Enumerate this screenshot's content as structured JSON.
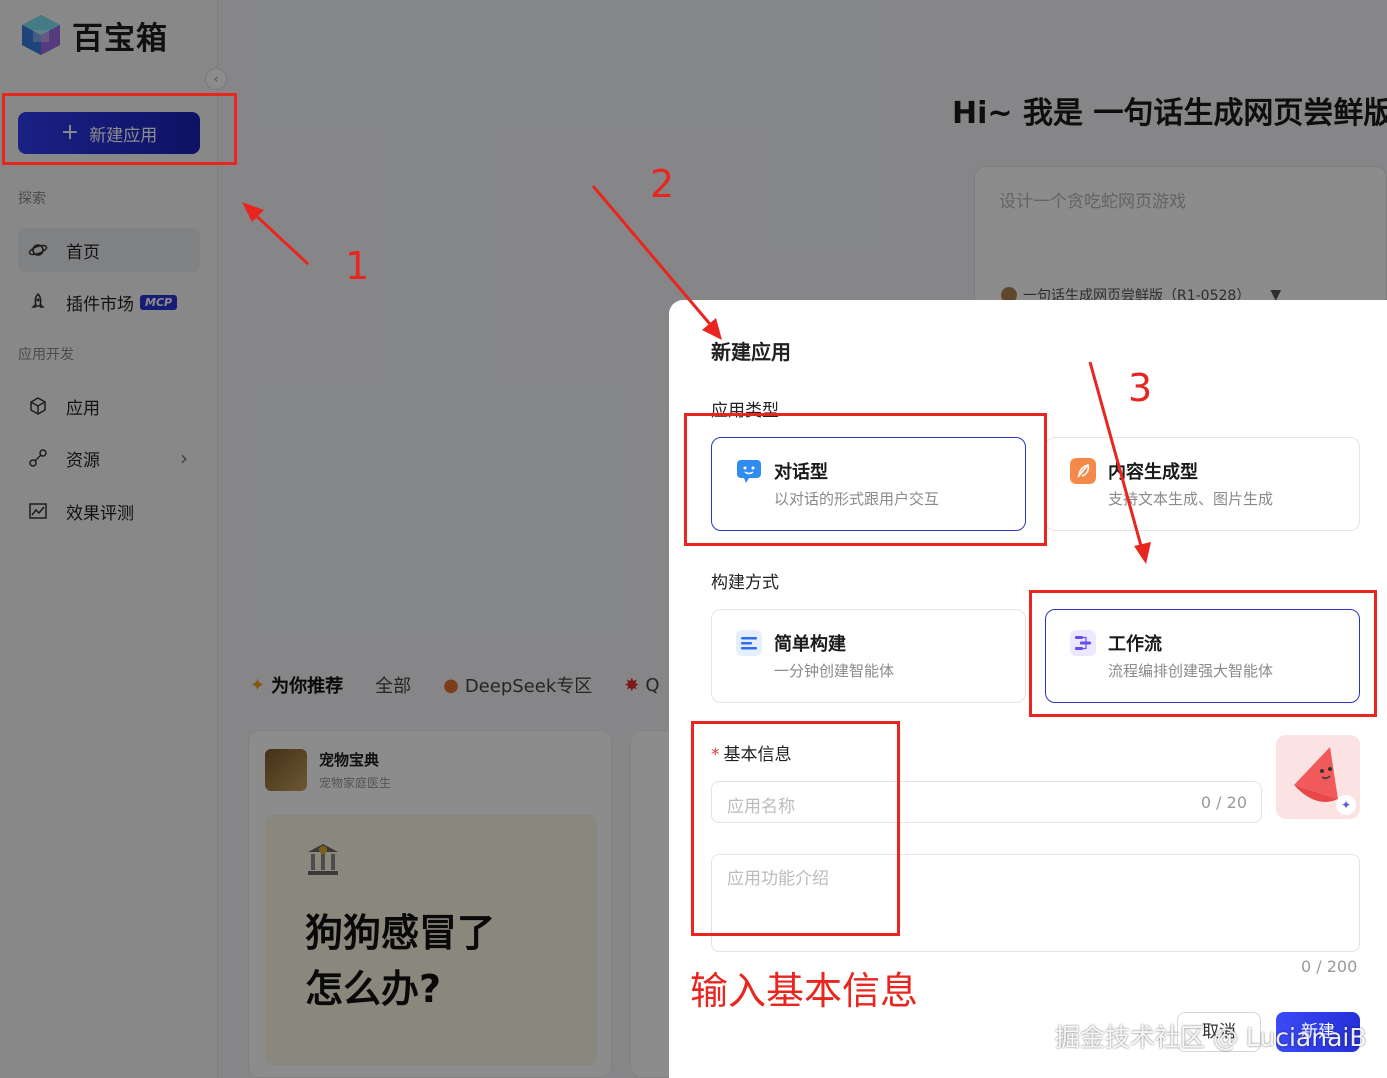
{
  "brand": {
    "name": "百宝箱"
  },
  "sidebar": {
    "new_app_label": "新建应用",
    "sections": {
      "explore": "探索",
      "dev": "应用开发"
    },
    "items": [
      {
        "label": "首页",
        "icon": "planet-icon"
      },
      {
        "label": "插件市场",
        "icon": "rocket-icon",
        "badge": "MCP"
      },
      {
        "label": "应用",
        "icon": "cube-icon"
      },
      {
        "label": "资源",
        "icon": "link-icon"
      },
      {
        "label": "效果评测",
        "icon": "chart-icon"
      }
    ]
  },
  "main": {
    "title": "Hi~ 我是 一句话生成网页尝鲜版",
    "prompt_placeholder": "设计一个贪吃蛇网页游戏",
    "model_name": "一句话生成网页尝鲜版（R1-0528）",
    "tabs": [
      "为你推荐",
      "全部",
      "DeepSeek专区",
      "Q"
    ],
    "card": {
      "name": "宠物宝典",
      "sub": "宠物家庭医生",
      "headline_1": "狗狗感冒了",
      "headline_2": "怎么办?"
    }
  },
  "modal": {
    "title": "新建应用",
    "app_type_label": "应用类型",
    "app_types": [
      {
        "title": "对话型",
        "desc": "以对话的形式跟用户交互",
        "selected": true
      },
      {
        "title": "内容生成型",
        "desc": "支持文本生成、图片生成",
        "selected": false
      }
    ],
    "build_label": "构建方式",
    "build_modes": [
      {
        "title": "简单构建",
        "desc": "一分钟创建智能体",
        "selected": false
      },
      {
        "title": "工作流",
        "desc": "流程编排创建强大智能体",
        "selected": true
      }
    ],
    "basic_info_label": "基本信息",
    "name_placeholder": "应用名称",
    "name_counter": "0 / 20",
    "desc_placeholder": "应用功能介绍",
    "desc_counter": "0 / 200",
    "cancel_label": "取消",
    "create_label": "新建"
  },
  "annotations": {
    "n1": "1",
    "n2": "2",
    "n3": "3",
    "note": "输入基本信息",
    "color": "#e8261f"
  },
  "watermark": "掘金技术社区 @ LucianaiB"
}
